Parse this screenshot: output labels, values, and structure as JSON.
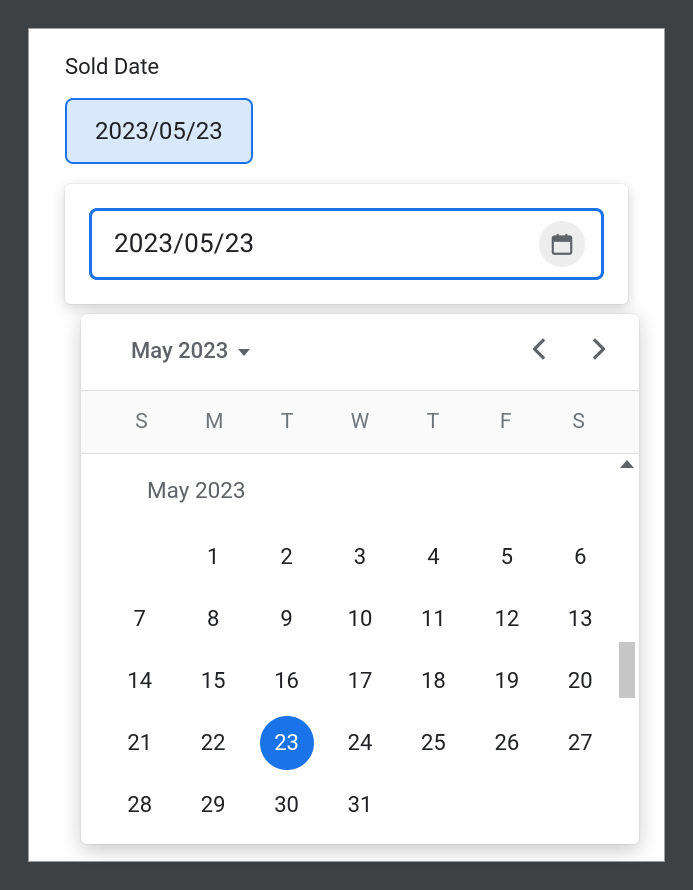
{
  "field": {
    "label": "Sold Date",
    "chip_value": "2023/05/23",
    "input_value": "2023/05/23"
  },
  "calendar": {
    "header_label": "May 2023",
    "weekdays": [
      "S",
      "M",
      "T",
      "W",
      "T",
      "F",
      "S"
    ],
    "month_title": "May 2023",
    "start_offset": 1,
    "days_in_month": 31,
    "selected_day": 23
  }
}
